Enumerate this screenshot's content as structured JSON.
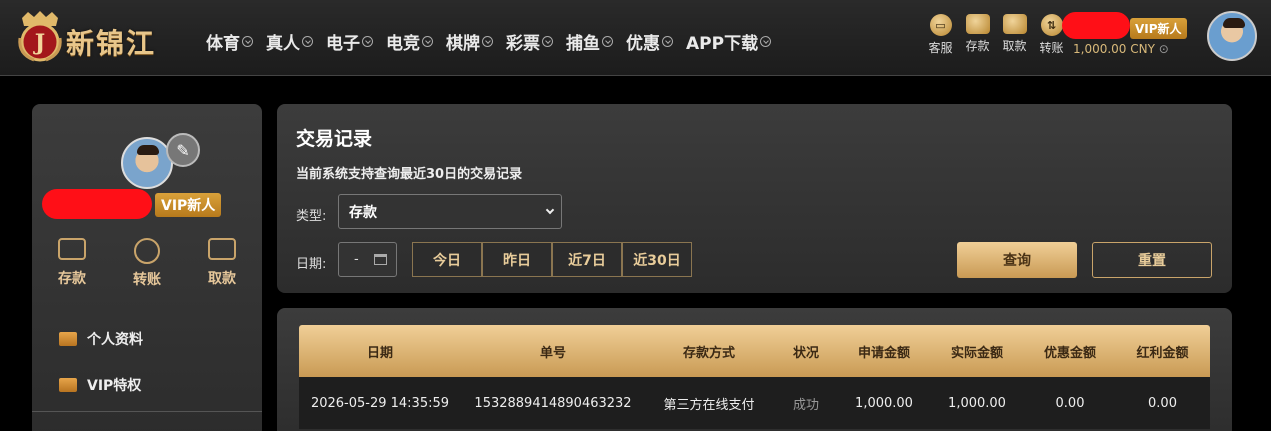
{
  "header": {
    "logo_text": "新锦江",
    "logo_letter": "J",
    "nav": [
      "体育",
      "真人",
      "电子",
      "电竞",
      "棋牌",
      "彩票",
      "捕鱼",
      "优惠",
      "APP下载"
    ],
    "quick_links": [
      {
        "label": "客服",
        "icon": "chat-icon"
      },
      {
        "label": "存款",
        "icon": "wallet-icon"
      },
      {
        "label": "取款",
        "icon": "briefcase-icon"
      },
      {
        "label": "转账",
        "icon": "transfer-icon"
      }
    ],
    "vip_badge": "VIP新人",
    "balance": "1,000.00 CNY"
  },
  "sidebar": {
    "vip_badge": "VIP新人",
    "actions": [
      {
        "label": "存款",
        "icon": "wallet-icon"
      },
      {
        "label": "转账",
        "icon": "transfer-icon"
      },
      {
        "label": "取款",
        "icon": "card-icon"
      }
    ],
    "menu": [
      {
        "label": "个人资料",
        "icon": "id-card-icon"
      },
      {
        "label": "VIP特权",
        "icon": "vip-card-icon"
      }
    ]
  },
  "panel": {
    "title": "交易记录",
    "subtitle": "当前系统支持查询最近30日的交易记录",
    "type_label": "类型:",
    "type_value": "存款",
    "date_label": "日期:",
    "date_value": "-",
    "ranges": [
      "今日",
      "昨日",
      "近7日",
      "近30日"
    ],
    "query_label": "查询",
    "reset_label": "重置"
  },
  "table": {
    "headers": [
      "日期",
      "单号",
      "存款方式",
      "状况",
      "申请金额",
      "实际金额",
      "优惠金额",
      "红利金额"
    ],
    "rows": [
      [
        "2026-05-29 14:35:59",
        "1532889414890463232",
        "第三方在线支付",
        "成功",
        "1,000.00",
        "1,000.00",
        "0.00",
        "0.00"
      ]
    ]
  },
  "colors": {
    "gold": "#c99a54",
    "gold_light": "#f0cf97",
    "redaction": "#ff0f17"
  }
}
